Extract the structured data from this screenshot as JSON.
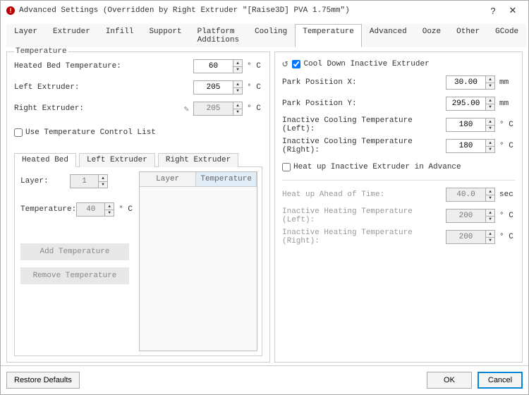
{
  "title": "Advanced Settings (Overridden by Right Extruder \"[Raise3D] PVA 1.75mm\")",
  "tabs": [
    "Layer",
    "Extruder",
    "Infill",
    "Support",
    "Platform Additions",
    "Cooling",
    "Temperature",
    "Advanced",
    "Ooze",
    "Other",
    "GCode"
  ],
  "active_tab": "Temperature",
  "temperature": {
    "legend": "Temperature",
    "heated_bed_label": "Heated Bed Temperature:",
    "heated_bed_value": "60",
    "left_ext_label": "Left Extruder:",
    "left_ext_value": "205",
    "right_ext_label": "Right Extruder:",
    "right_ext_value": "205",
    "degc": "° C",
    "use_tcl_label": "Use Temperature Control List"
  },
  "tcl": {
    "tabs": [
      "Heated Bed",
      "Left Extruder",
      "Right Extruder"
    ],
    "active": "Heated Bed",
    "layer_label": "Layer:",
    "layer_value": "1",
    "temp_label": "Temperature:",
    "temp_value": "40",
    "degc": "° C",
    "add_btn": "Add Temperature",
    "remove_btn": "Remove Temperature",
    "col_layer": "Layer",
    "col_temp": "Temperature"
  },
  "cooldown": {
    "checkbox_label": "Cool Down Inactive Extruder",
    "park_x_label": "Park Position X:",
    "park_x_value": "30.00",
    "park_y_label": "Park Position Y:",
    "park_y_value": "295.00",
    "mm": "mm",
    "degc": "° C",
    "sec": "sec",
    "ict_left_label": "Inactive Cooling Temperature (Left):",
    "ict_left_value": "180",
    "ict_right_label": "Inactive Cooling Temperature (Right):",
    "ict_right_value": "180",
    "heatup_checkbox": "Heat up Inactive Extruder in Advance",
    "heat_ahead_label": "Heat up Ahead of Time:",
    "heat_ahead_value": "40.0",
    "iht_left_label": "Inactive Heating Temperature (Left):",
    "iht_left_value": "200",
    "iht_right_label": "Inactive Heating Temperature (Right):",
    "iht_right_value": "200"
  },
  "footer": {
    "restore": "Restore Defaults",
    "ok": "OK",
    "cancel": "Cancel"
  }
}
